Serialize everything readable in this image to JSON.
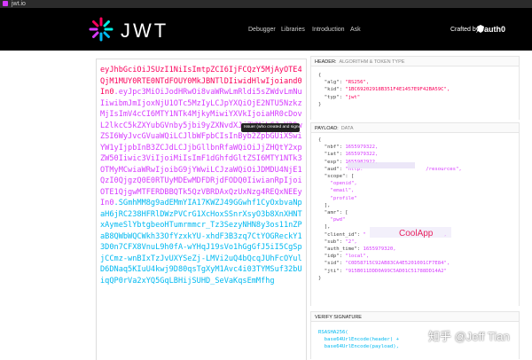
{
  "browser": {
    "tab_title": "jwt.io"
  },
  "header": {
    "logo_text": "JWT",
    "nav": [
      "Debugger",
      "Libraries",
      "Introduction",
      "Ask"
    ],
    "crafted_by": "Crafted by",
    "brand": "auth0"
  },
  "encoded": {
    "header_part": "eyJhbGciOiJSUzI1NiIsImtpZCI6IjFCQzY5MjAyOTE4QjM1MUY0RTE0NTdFOUY0MkJBNTlDIiwidHlwIjoiand0In0",
    "payload_part": "eyJpc3MiOiJodHRwOi8vaWRwLmRldi5sZWdvLmNuIiwibmJmIjoxNjU1OTc5MzIyLCJpYXQiOjE2NTU5NzkzMjIsImV4cCI6MTY1NTk4MjkyMiwiYXVkIjoiaHR0cDovL2lkcC5kZXYubGVnby5jbi9yZXNvdXJjZXMiLCJzY29wZSI6WyJvcGVuaWQiLCJlbWFpbCIsInByb2ZpbGUiXSwiYW1yIjpbInB3ZCJdLCJjbGllbnRfaWQiOiJjZHQtY2xpZW50Iiwic3ViIjoiMiIsImF1dGhfdGltZSI6MTY1NTk3OTMyMCwiaWRwIjoibG9jYWwiLCJzaWQiOiJDMDU4NjE1QzI0QjgzQ0E0RTUyMDEwMDFDRjdFODQ0IiwianRpIjoiOTE1QjgwMTFERDBBQTk5QzVBRDAxQzUxNzg4REQxNEEyIn0",
    "signature_part": "SGmhMM8g9adEMmYIA17KWZJ49GGwhf1CyOxbvaNpaH6jRC238HFRlDWzPVCrG1XcHoxSSnrXsyO3b8XnXHNTxAymeSlYbtgbeoHTumrmmcr_Tz3SezyNHN8y3os11nZPaB8QWbWQCWkh33OfYzxkYU-xhdF3B3zq7CtYOGReckY13D0n7CFX8VnuL9h0fA-wYHqJ19sVo1hGgGfJ5iI5CgSpjCCmz-wnBIxTzJvUXYSeZj-LMVi2uQ4bQcqJUhFcOYulD6DNaq5KIuU4kwj9D80qsTgXyM1Avc4i03TYMSuf32bUiqQP0rVa2xYQ5GqLBHijSUHD_SeVaKqsEmMfhg"
  },
  "tooltip": "Issuer (who created and signed this token)",
  "decoded": {
    "header_title": "HEADER:",
    "header_sub": "ALGORITHM & TOKEN TYPE",
    "payload_title": "PAYLOAD:",
    "payload_sub": "DATA",
    "verify_title": "VERIFY SIGNATURE",
    "header_json": {
      "alg": "RS256",
      "kid": "1BC69202918B351F4E1457E9F42BA59C",
      "typ": "jwt"
    },
    "payload": {
      "nbf": "1655979322",
      "iat": "1655979322",
      "exp": "1655982922",
      "aud_prefix": "http:",
      "aud_suffix": "/resources",
      "scope_items": [
        "openid",
        "email",
        "profile"
      ],
      "amr_items": [
        "pwd"
      ],
      "client_id_prefix": "\"",
      "client_id_suffix": ",",
      "client_id_overlay": "CoolApp",
      "sub": "2",
      "auth_time": "1655979320",
      "idp": "local",
      "sid": "C0D58715C92AB83CA4E5201001CF7E84",
      "jti": "915B011DDD0A99C5AD01C51788DD14A2"
    },
    "verify": {
      "algo": "RSASHA256(",
      "line1": "base64UrlEncode(header) +",
      "line2": "base64UrlEncode(payload),"
    }
  },
  "watermark": "知乎 @Jeff Tian"
}
